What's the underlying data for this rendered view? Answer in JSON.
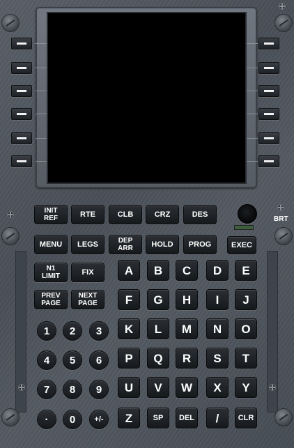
{
  "panel": {
    "brt_label": "BRT",
    "lsk_left": [
      "",
      "",
      "",
      "",
      "",
      ""
    ],
    "lsk_right": [
      "",
      "",
      "",
      "",
      "",
      ""
    ]
  },
  "function_keys": {
    "init_ref": "INIT\nREF",
    "rte": "RTE",
    "clb": "CLB",
    "crz": "CRZ",
    "des": "DES",
    "menu": "MENU",
    "legs": "LEGS",
    "dep_arr": "DEP\nARR",
    "hold": "HOLD",
    "prog": "PROG",
    "exec": "EXEC",
    "n1_limit": "N1\nLIMIT",
    "fix": "FIX",
    "prev_page": "PREV\nPAGE",
    "next_page": "NEXT\nPAGE"
  },
  "alpha_keys": [
    "A",
    "B",
    "C",
    "D",
    "E",
    "F",
    "G",
    "H",
    "I",
    "J",
    "K",
    "L",
    "M",
    "N",
    "O",
    "P",
    "Q",
    "R",
    "S",
    "T",
    "U",
    "V",
    "W",
    "X",
    "Y",
    "Z",
    "SP",
    "DEL",
    "/",
    "CLR"
  ],
  "numeric_keys": [
    "1",
    "2",
    "3",
    "4",
    "5",
    "6",
    "7",
    "8",
    "9",
    "·",
    "0",
    "+/-"
  ]
}
